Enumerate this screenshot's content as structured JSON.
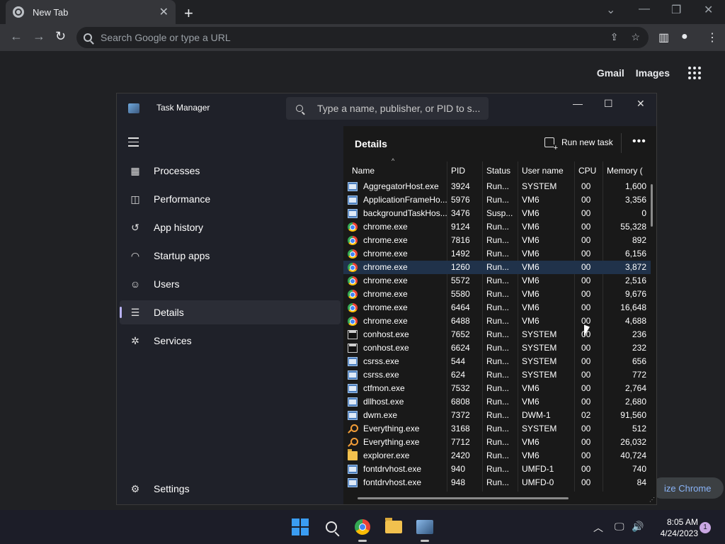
{
  "browser": {
    "tab_title": "New Tab",
    "omnibox_placeholder": "Search Google or type a URL",
    "links": {
      "gmail": "Gmail",
      "images": "Images"
    },
    "customize_label": "ize Chrome"
  },
  "task_manager": {
    "title": "Task Manager",
    "search_placeholder": "Type a name, publisher, or PID to s...",
    "nav": [
      {
        "label": "Processes",
        "icon": "processes-icon"
      },
      {
        "label": "Performance",
        "icon": "performance-icon"
      },
      {
        "label": "App history",
        "icon": "app-history-icon"
      },
      {
        "label": "Startup apps",
        "icon": "startup-apps-icon"
      },
      {
        "label": "Users",
        "icon": "users-icon"
      },
      {
        "label": "Details",
        "icon": "details-icon",
        "active": true
      },
      {
        "label": "Services",
        "icon": "services-icon"
      }
    ],
    "settings_label": "Settings",
    "section_title": "Details",
    "run_new_task": "Run new task",
    "columns": [
      "Name",
      "PID",
      "Status",
      "User name",
      "CPU",
      "Memory ("
    ],
    "rows": [
      {
        "icon": "exe",
        "name": "AggregatorHost.exe",
        "pid": "3924",
        "status": "Run...",
        "user": "SYSTEM",
        "cpu": "00",
        "mem": "1,600"
      },
      {
        "icon": "exe",
        "name": "ApplicationFrameHo...",
        "pid": "5976",
        "status": "Run...",
        "user": "VM6",
        "cpu": "00",
        "mem": "3,356"
      },
      {
        "icon": "exe",
        "name": "backgroundTaskHos...",
        "pid": "3476",
        "status": "Susp...",
        "user": "VM6",
        "cpu": "00",
        "mem": "0"
      },
      {
        "icon": "chrome",
        "name": "chrome.exe",
        "pid": "9124",
        "status": "Run...",
        "user": "VM6",
        "cpu": "00",
        "mem": "55,328"
      },
      {
        "icon": "chrome",
        "name": "chrome.exe",
        "pid": "7816",
        "status": "Run...",
        "user": "VM6",
        "cpu": "00",
        "mem": "892"
      },
      {
        "icon": "chrome",
        "name": "chrome.exe",
        "pid": "1492",
        "status": "Run...",
        "user": "VM6",
        "cpu": "00",
        "mem": "6,156"
      },
      {
        "icon": "chrome",
        "name": "chrome.exe",
        "pid": "1260",
        "status": "Run...",
        "user": "VM6",
        "cpu": "00",
        "mem": "3,872",
        "selected": true
      },
      {
        "icon": "chrome",
        "name": "chrome.exe",
        "pid": "5572",
        "status": "Run...",
        "user": "VM6",
        "cpu": "00",
        "mem": "2,516"
      },
      {
        "icon": "chrome",
        "name": "chrome.exe",
        "pid": "5580",
        "status": "Run...",
        "user": "VM6",
        "cpu": "00",
        "mem": "9,676"
      },
      {
        "icon": "chrome",
        "name": "chrome.exe",
        "pid": "6464",
        "status": "Run...",
        "user": "VM6",
        "cpu": "00",
        "mem": "16,648"
      },
      {
        "icon": "chrome",
        "name": "chrome.exe",
        "pid": "6488",
        "status": "Run...",
        "user": "VM6",
        "cpu": "00",
        "mem": "4,688"
      },
      {
        "icon": "console",
        "name": "conhost.exe",
        "pid": "7652",
        "status": "Run...",
        "user": "SYSTEM",
        "cpu": "00",
        "mem": "236"
      },
      {
        "icon": "console",
        "name": "conhost.exe",
        "pid": "6624",
        "status": "Run...",
        "user": "SYSTEM",
        "cpu": "00",
        "mem": "232"
      },
      {
        "icon": "exe",
        "name": "csrss.exe",
        "pid": "544",
        "status": "Run...",
        "user": "SYSTEM",
        "cpu": "00",
        "mem": "656"
      },
      {
        "icon": "exe",
        "name": "csrss.exe",
        "pid": "624",
        "status": "Run...",
        "user": "SYSTEM",
        "cpu": "00",
        "mem": "772"
      },
      {
        "icon": "exe",
        "name": "ctfmon.exe",
        "pid": "7532",
        "status": "Run...",
        "user": "VM6",
        "cpu": "00",
        "mem": "2,764"
      },
      {
        "icon": "exe",
        "name": "dllhost.exe",
        "pid": "6808",
        "status": "Run...",
        "user": "VM6",
        "cpu": "00",
        "mem": "2,680"
      },
      {
        "icon": "exe",
        "name": "dwm.exe",
        "pid": "7372",
        "status": "Run...",
        "user": "DWM-1",
        "cpu": "02",
        "mem": "91,560"
      },
      {
        "icon": "search",
        "name": "Everything.exe",
        "pid": "3168",
        "status": "Run...",
        "user": "SYSTEM",
        "cpu": "00",
        "mem": "512"
      },
      {
        "icon": "search",
        "name": "Everything.exe",
        "pid": "7712",
        "status": "Run...",
        "user": "VM6",
        "cpu": "00",
        "mem": "26,032"
      },
      {
        "icon": "folder",
        "name": "explorer.exe",
        "pid": "2420",
        "status": "Run...",
        "user": "VM6",
        "cpu": "00",
        "mem": "40,724"
      },
      {
        "icon": "exe",
        "name": "fontdrvhost.exe",
        "pid": "940",
        "status": "Run...",
        "user": "UMFD-1",
        "cpu": "00",
        "mem": "740"
      },
      {
        "icon": "exe",
        "name": "fontdrvhost.exe",
        "pid": "948",
        "status": "Run...",
        "user": "UMFD-0",
        "cpu": "00",
        "mem": "84"
      }
    ]
  },
  "taskbar": {
    "time": "8:05 AM",
    "date": "4/24/2023",
    "notifications": "1"
  }
}
